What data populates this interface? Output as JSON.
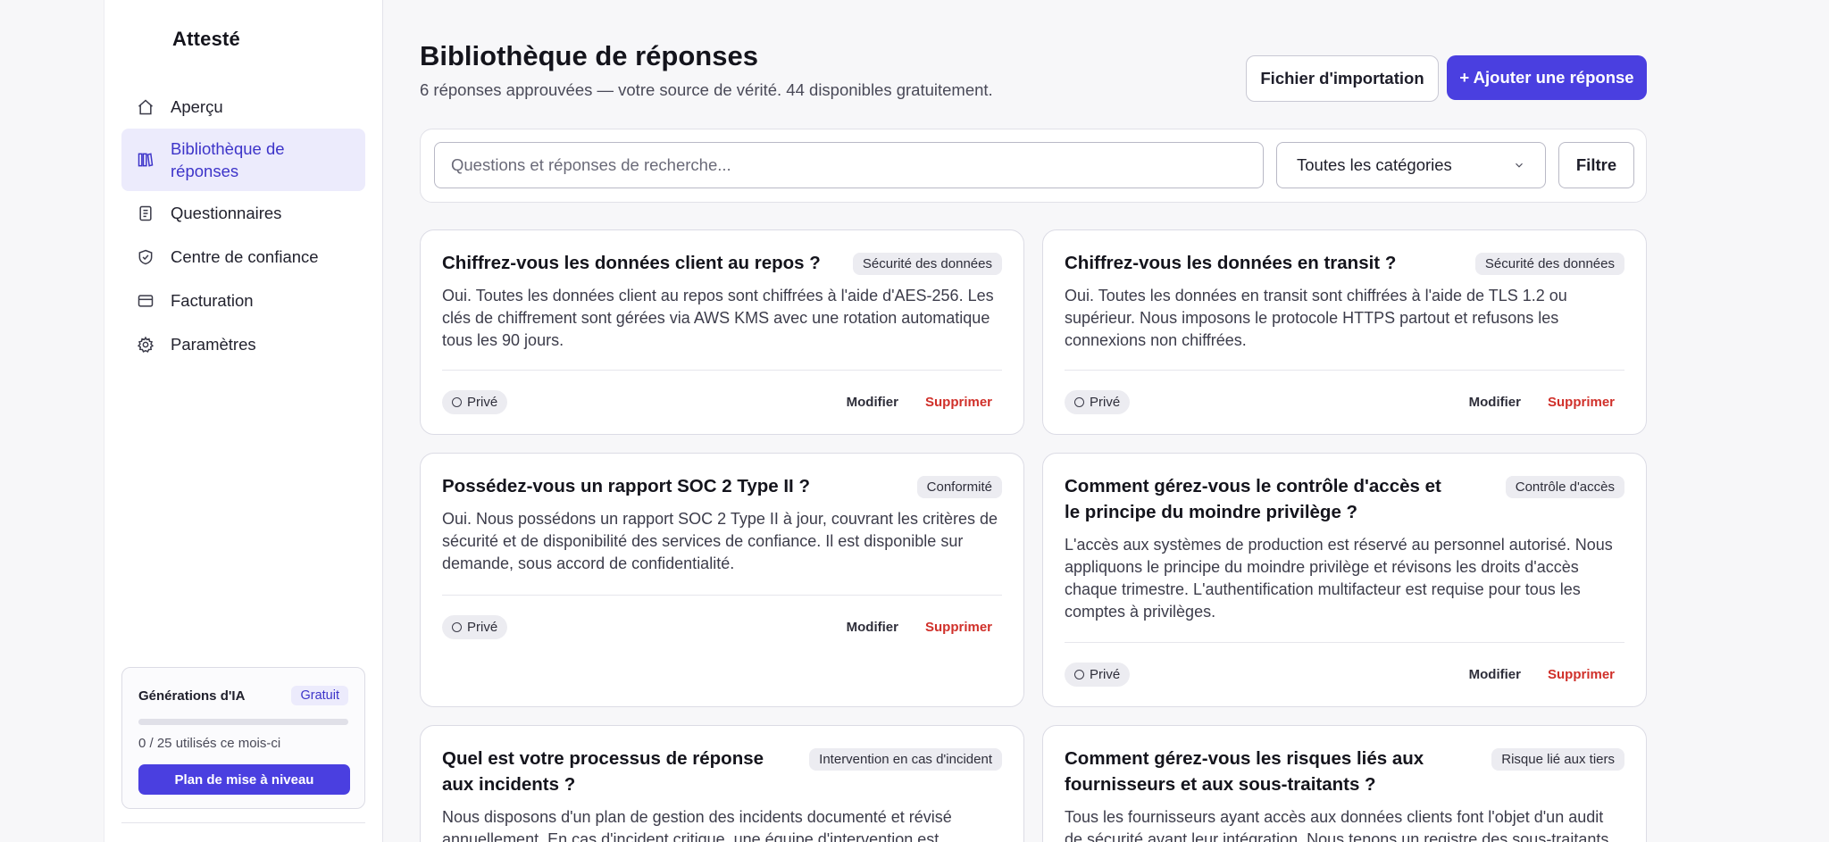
{
  "app": {
    "brand": "Attesté"
  },
  "sidebar": {
    "items": [
      {
        "label": "Aperçu",
        "icon": "home-icon"
      },
      {
        "label": "Bibliothèque de réponses",
        "icon": "library-icon",
        "active": true
      },
      {
        "label": "Questionnaires",
        "icon": "clipboard-icon"
      },
      {
        "label": "Centre de confiance",
        "icon": "shield-icon"
      },
      {
        "label": "Facturation",
        "icon": "credit-card-icon"
      },
      {
        "label": "Paramètres",
        "icon": "gear-icon"
      }
    ],
    "ai_card": {
      "title": "Générations d'IA",
      "badge": "Gratuit",
      "usage": "0 / 25 utilisés ce mois-ci",
      "progress_fraction": 0,
      "upgrade_label": "Plan de mise à niveau"
    }
  },
  "header": {
    "title": "Bibliothèque de réponses",
    "subtitle": "6 réponses approuvées — votre source de vérité. 44 disponibles gratuitement.",
    "import_label": "Fichier d'importation",
    "add_label": "+ Ajouter une réponse"
  },
  "search": {
    "placeholder": "Questions et réponses de recherche...",
    "category_selected": "Toutes les catégories",
    "filter_label": "Filtre"
  },
  "cards": [
    {
      "question": "Chiffrez-vous les données client au repos ?",
      "category": "Sécurité des données",
      "answer": "Oui. Toutes les données client au repos sont chiffrées à l'aide d'AES-256. Les clés de chiffrement sont gérées via AWS KMS avec une rotation automatique tous les 90 jours.",
      "visibility": "Privé",
      "edit": "Modifier",
      "delete": "Supprimer"
    },
    {
      "question": "Chiffrez-vous les données en transit ?",
      "category": "Sécurité des données",
      "answer": "Oui. Toutes les données en transit sont chiffrées à l'aide de TLS 1.2 ou supérieur. Nous imposons le protocole HTTPS partout et refusons les connexions non chiffrées.",
      "visibility": "Privé",
      "edit": "Modifier",
      "delete": "Supprimer"
    },
    {
      "question": "Possédez-vous un rapport SOC 2 Type II ?",
      "category": "Conformité",
      "answer": "Oui. Nous possédons un rapport SOC 2 Type II à jour, couvrant les critères de sécurité et de disponibilité des services de confiance. Il est disponible sur demande, sous accord de confidentialité.",
      "visibility": "Privé",
      "edit": "Modifier",
      "delete": "Supprimer"
    },
    {
      "question": "Comment gérez-vous le contrôle d'accès et le principe du moindre privilège ?",
      "category": "Contrôle d'accès",
      "answer": "L'accès aux systèmes de production est réservé au personnel autorisé. Nous appliquons le principe du moindre privilège et révisons les droits d'accès chaque trimestre. L'authentification multifacteur est requise pour tous les comptes à privilèges.",
      "visibility": "Privé",
      "edit": "Modifier",
      "delete": "Supprimer"
    },
    {
      "question": "Quel est votre processus de réponse aux incidents ?",
      "category": "Intervention en cas d'incident",
      "answer": "Nous disposons d'un plan de gestion des incidents documenté et révisé annuellement. En cas d'incident critique, une équipe d'intervention est"
    },
    {
      "question": "Comment gérez-vous les risques liés aux fournisseurs et aux sous-traitants ?",
      "category": "Risque lié aux tiers",
      "answer": "Tous les fournisseurs ayant accès aux données clients font l'objet d'un audit de sécurité avant leur intégration. Nous tenons un registre des sous-traitants"
    }
  ],
  "colors": {
    "accent": "#4a3fe0",
    "active_bg": "#ecebfc",
    "delete": "#d0302a"
  }
}
